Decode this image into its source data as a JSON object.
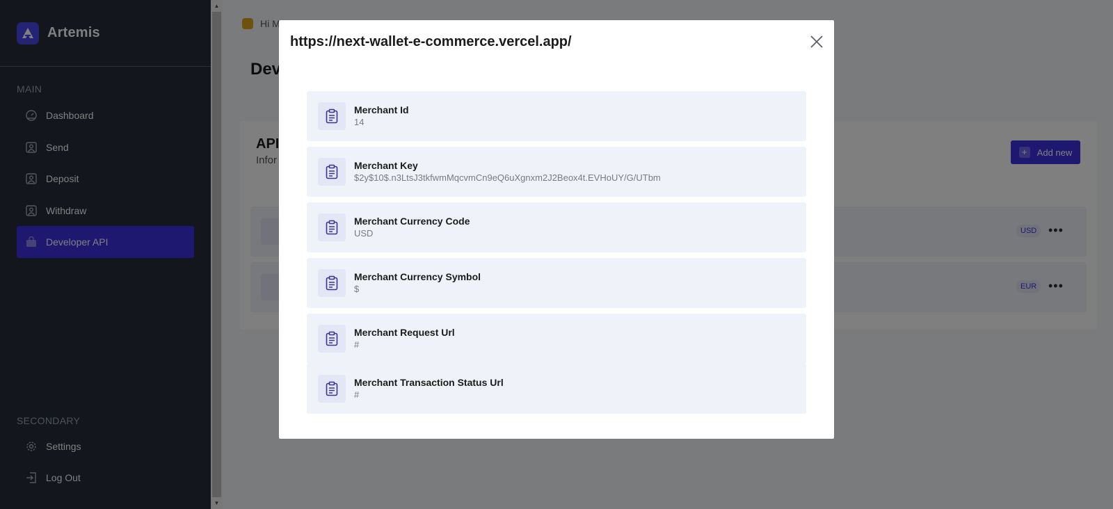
{
  "sidebar": {
    "brand": "Artemis",
    "main_label": "MAIN",
    "secondary_label": "SECONDARY",
    "items": [
      {
        "label": "Dashboard",
        "icon": "dashboard-icon"
      },
      {
        "label": "Send",
        "icon": "user-square-icon"
      },
      {
        "label": "Deposit",
        "icon": "user-square-icon"
      },
      {
        "label": "Withdraw",
        "icon": "user-square-icon"
      },
      {
        "label": "Developer API",
        "icon": "bag-icon",
        "active": true
      }
    ],
    "secondary_items": [
      {
        "label": "Settings",
        "icon": "gear-icon"
      },
      {
        "label": "Log Out",
        "icon": "logout-icon"
      }
    ]
  },
  "main": {
    "greeting": "Hi M",
    "page_title": "Dev",
    "card": {
      "title": "API",
      "subtitle": "Infor",
      "add_button": "Add new",
      "rows": [
        {
          "currency": "USD"
        },
        {
          "currency": "EUR"
        }
      ]
    }
  },
  "modal": {
    "title": "https://next-wallet-e-commerce.vercel.app/",
    "items": [
      {
        "label": "Merchant Id",
        "value": "14"
      },
      {
        "label": "Merchant Key",
        "value": "$2y$10$.n3LtsJ3tkfwmMqcvmCn9eQ6uXgnxm2J2Beox4t.EVHoUY/G/UTbm"
      },
      {
        "label": "Merchant Currency Code",
        "value": "USD"
      },
      {
        "label": "Merchant Currency Symbol",
        "value": "$"
      },
      {
        "label": "Merchant Request Url",
        "value": "#"
      },
      {
        "label": "Merchant Transaction Status Url",
        "value": "#"
      }
    ]
  },
  "colors": {
    "accent": "#3d31e3",
    "sidebar_bg": "#262d3a",
    "item_bg": "#f0f2f9"
  }
}
